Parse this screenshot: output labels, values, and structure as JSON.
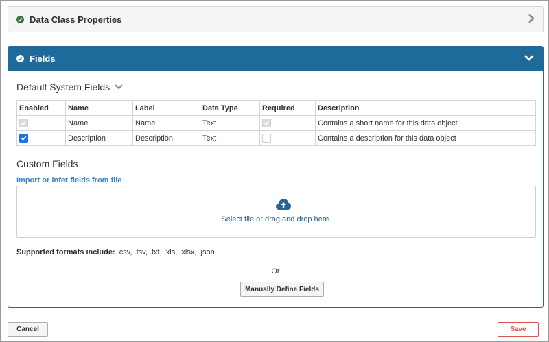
{
  "panels": {
    "properties": {
      "title": "Data Class Properties"
    },
    "fields": {
      "title": "Fields"
    }
  },
  "system_fields": {
    "heading": "Default System Fields",
    "columns": [
      "Enabled",
      "Name",
      "Label",
      "Data Type",
      "Required",
      "Description"
    ],
    "rows": [
      {
        "enabled": "checked-disabled",
        "name": "Name",
        "label": "Name",
        "data_type": "Text",
        "required": "checked-disabled",
        "description": "Contains a short name for this data object"
      },
      {
        "enabled": "checked",
        "name": "Description",
        "label": "Description",
        "data_type": "Text",
        "required": "unchecked-disabled",
        "description": "Contains a description for this data object"
      }
    ]
  },
  "custom_fields": {
    "heading": "Custom Fields",
    "import_link": "Import or infer fields from file",
    "dropzone_text": "Select file or drag and drop here.",
    "formats_label": "Supported formats include:",
    "formats_value": " .csv, .tsv, .txt, .xls, .xlsx, .json",
    "or_text": "Or",
    "manual_button": "Manually Define Fields"
  },
  "footer": {
    "cancel": "Cancel",
    "save": "Save"
  },
  "colors": {
    "header_blue": "#1e6a9a",
    "success_green": "#3c763d",
    "link_blue": "#3a87c7",
    "danger_red": "#d9534f"
  }
}
